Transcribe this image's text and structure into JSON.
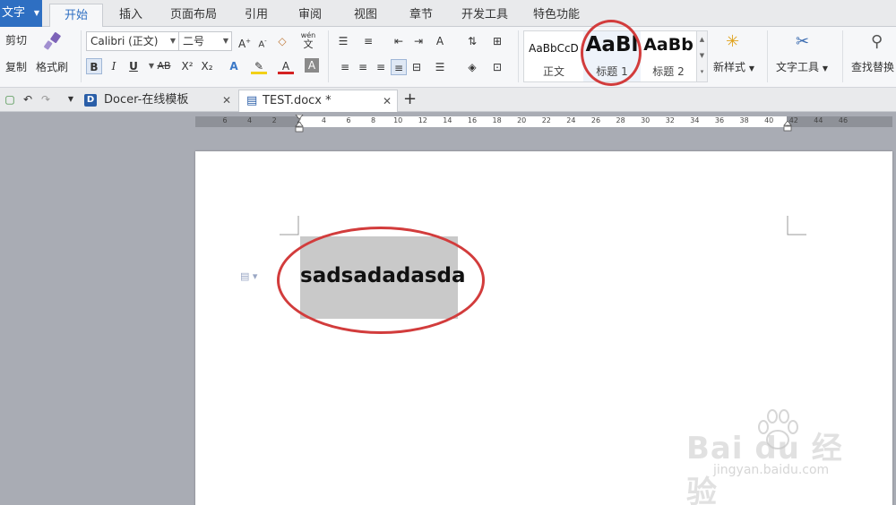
{
  "menubar": {
    "app_label": "文字",
    "tabs": [
      "开始",
      "插入",
      "页面布局",
      "引用",
      "审阅",
      "视图",
      "章节",
      "开发工具",
      "特色功能"
    ],
    "active_tab": "开始"
  },
  "ribbon": {
    "cut_label": "剪切",
    "copy_label": "复制",
    "format_painter_label": "格式刷",
    "font_name": "Calibri (正文)",
    "font_size": "二号",
    "pinyin_label": "wén",
    "bold_label": "B",
    "italic_label": "I",
    "underline_label": "U",
    "strike_label": "AB",
    "superscript_label": "X²",
    "subscript_label": "X₂",
    "styles": [
      {
        "sample": "AaBbCcD",
        "label": "正文"
      },
      {
        "sample": "AaBl",
        "label": "标题 1"
      },
      {
        "sample": "AaBb",
        "label": "标题 2"
      }
    ],
    "new_style_label": "新样式",
    "text_tools_label": "文字工具",
    "find_replace_label": "查找替换"
  },
  "docbar": {
    "tabs": [
      {
        "title": "Docer-在线模板"
      },
      {
        "title": "TEST.docx *"
      }
    ],
    "new_tab_label": "+"
  },
  "ruler": {
    "ticks": [
      "6",
      "4",
      "2",
      "2",
      "4",
      "6",
      "8",
      "10",
      "12",
      "14",
      "16",
      "18",
      "20",
      "22",
      "24",
      "26",
      "28",
      "30",
      "32",
      "34",
      "36",
      "38",
      "40",
      "42",
      "44",
      "46"
    ]
  },
  "document": {
    "body_text": "sadsadadasda"
  },
  "watermark": {
    "brand": "Bai  du 经验",
    "url": "jingyan.baidu.com"
  },
  "colors": {
    "accent": "#2e6fc2",
    "annotation": "#d23c3c",
    "selection": "#c9c9c9"
  }
}
